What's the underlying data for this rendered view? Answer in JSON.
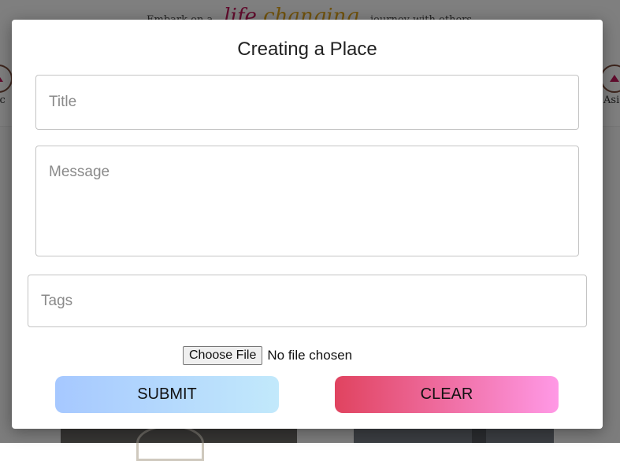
{
  "background": {
    "tagline": {
      "prefix": "Embark on a",
      "script_word_1": "life",
      "script_word_2": "changing",
      "suffix": "journey with others"
    },
    "categories": {
      "left_label": "ric",
      "right_label": "Asia"
    }
  },
  "modal": {
    "title": "Creating a Place",
    "fields": {
      "title_placeholder": "Title",
      "message_placeholder": "Message",
      "tags_placeholder": "Tags"
    },
    "file_input": {
      "button_label": "Choose File",
      "status": "No file chosen"
    },
    "buttons": {
      "submit_label": "SUBMIT",
      "clear_label": "CLEAR"
    }
  },
  "colors": {
    "overlay": "rgba(0,0,0,0.5)",
    "submit_gradient": [
      "#a6c8ff",
      "#c2e9fb"
    ],
    "clear_gradient": [
      "#e0435f",
      "#ff99e6"
    ]
  }
}
